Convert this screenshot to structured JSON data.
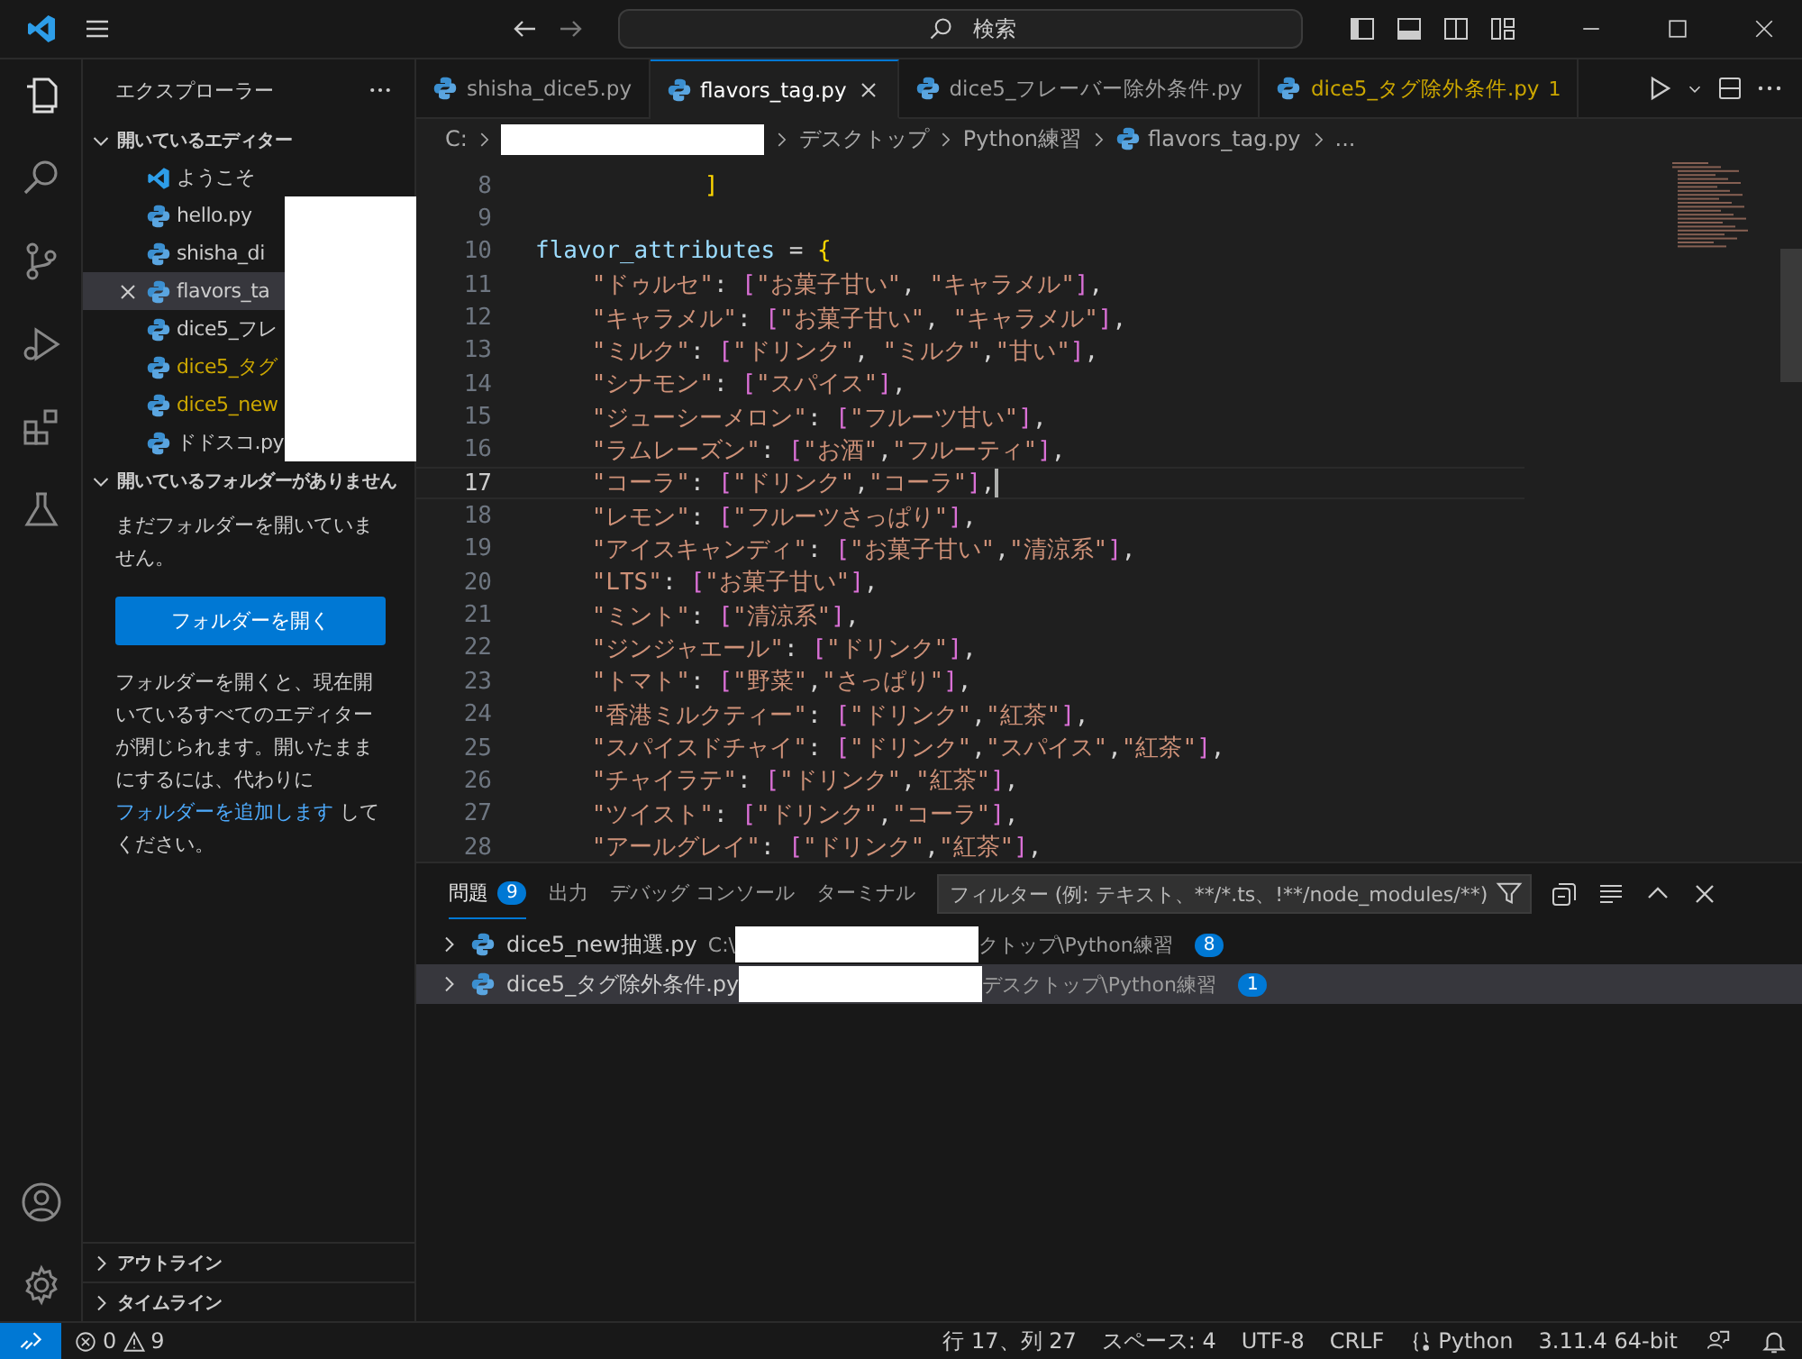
{
  "title_bar": {
    "search_placeholder": "検索"
  },
  "sidebar": {
    "title": "エクスプローラー",
    "open_editors": {
      "title": "開いているエディター",
      "expanded": true,
      "items": [
        {
          "label": "ようこそ",
          "kind": "welcome",
          "selected": false,
          "warning": false
        },
        {
          "label": "hello.py",
          "kind": "python",
          "selected": false,
          "warning": false
        },
        {
          "label": "shisha_di",
          "kind": "python",
          "selected": false,
          "warning": false
        },
        {
          "label": "flavors_ta",
          "kind": "python",
          "selected": true,
          "warning": false
        },
        {
          "label": "dice5_フレ",
          "kind": "python",
          "selected": false,
          "warning": false
        },
        {
          "label": "dice5_タグ",
          "kind": "python",
          "selected": false,
          "warning": true
        },
        {
          "label": "dice5_new",
          "kind": "python",
          "selected": false,
          "warning": true
        },
        {
          "label": "ドドスコ.py",
          "kind": "python",
          "selected": false,
          "warning": false
        }
      ]
    },
    "no_folder": {
      "title": "開いているフォルダーがありません",
      "expanded": true,
      "message": "まだフォルダーを開いていません。",
      "button": "フォルダーを開く",
      "note_before": "フォルダーを開くと、現在開いているすべてのエディターが閉じられます。開いたままにするには、代わりに ",
      "note_link": "フォルダーを追加します",
      "note_after": " してください。"
    },
    "bottom_sections": [
      {
        "title": "アウトライン",
        "expanded": false
      },
      {
        "title": "タイムライン",
        "expanded": false
      }
    ]
  },
  "tabs": [
    {
      "label": "shisha_dice5.py",
      "selected": false,
      "warning": false
    },
    {
      "label": "flavors_tag.py",
      "selected": true,
      "warning": false
    },
    {
      "label": "dice5_フレーバー除外条件.py",
      "selected": false,
      "warning": false
    },
    {
      "label": "dice5_タグ除外条件.py",
      "badge": "1",
      "selected": false,
      "warning": true
    }
  ],
  "breadcrumb": {
    "drive": "C:",
    "parts": [
      "デスクトップ",
      "Python練習",
      "flavors_tag.py",
      "..."
    ]
  },
  "code_lines": [
    {
      "number": "8",
      "text": "            ]",
      "current": false
    },
    {
      "number": "9",
      "current": false
    },
    {
      "number": "10",
      "text": "flavor_attributes = {",
      "current": false
    },
    {
      "number": "11",
      "text": "    \"ドゥルセ\": [\"お菓子甘い\", \"キャラメル\"],",
      "current": false
    },
    {
      "number": "12",
      "text": "    \"キャラメル\": [\"お菓子甘い\", \"キャラメル\"],",
      "current": false
    },
    {
      "number": "13",
      "text": "    \"ミルク\": [\"ドリンク\", \"ミルク\",\"甘い\"],",
      "current": false
    },
    {
      "number": "14",
      "text": "    \"シナモン\": [\"スパイス\"],",
      "current": false
    },
    {
      "number": "15",
      "text": "    \"ジューシーメロン\": [\"フルーツ甘い\"],",
      "current": false
    },
    {
      "number": "16",
      "text": "    \"ラムレーズン\": [\"お酒\",\"フルーティ\"],",
      "current": false
    },
    {
      "number": "17",
      "text": "    \"コーラ\": [\"ドリンク\",\"コーラ\"],",
      "current": true
    },
    {
      "number": "18",
      "text": "    \"レモン\": [\"フルーツさっぱり\"],",
      "current": false
    },
    {
      "number": "19",
      "text": "    \"アイスキャンディ\": [\"お菓子甘い\",\"清涼系\"],",
      "current": false
    },
    {
      "number": "20",
      "text": "    \"LTS\": [\"お菓子甘い\"],",
      "current": false
    },
    {
      "number": "21",
      "text": "    \"ミント\": [\"清涼系\"],",
      "current": false
    },
    {
      "number": "22",
      "text": "    \"ジンジャエール\": [\"ドリンク\"],",
      "current": false
    },
    {
      "number": "23",
      "text": "    \"トマト\": [\"野菜\",\"さっぱり\"],",
      "current": false
    },
    {
      "number": "24",
      "text": "    \"香港ミルクティー\": [\"ドリンク\",\"紅茶\"],",
      "current": false
    },
    {
      "number": "25",
      "text": "    \"スパイスドチャイ\": [\"ドリンク\",\"スパイス\",\"紅茶\"],",
      "current": false
    },
    {
      "number": "26",
      "text": "    \"チャイラテ\": [\"ドリンク\",\"紅茶\"],",
      "current": false
    },
    {
      "number": "27",
      "text": "    \"ツイスト\": [\"ドリンク\",\"コーラ\"],",
      "current": false
    },
    {
      "number": "28",
      "text": "    \"アールグレイ\": [\"ドリンク\",\"紅茶\"],",
      "current": false
    }
  ],
  "panel": {
    "tabs": [
      {
        "label": "問題",
        "badge": "9",
        "selected": true
      },
      {
        "label": "出力",
        "selected": false
      },
      {
        "label": "デバッグ コンソール",
        "selected": false
      },
      {
        "label": "ターミナル",
        "selected": false
      }
    ],
    "filter_placeholder": "フィルター (例: テキスト、**/*.ts、!**/node_modules/**)",
    "problems": [
      {
        "file": "dice5_new抽選.py",
        "path_start": "C:\\",
        "path_end": "クトップ\\Python練習",
        "count": "8",
        "expanded": false,
        "selected": false
      },
      {
        "file": "dice5_タグ除外条件.py",
        "path_end": "デスクトップ\\Python練習",
        "count": "1",
        "expanded": false,
        "selected": true
      }
    ]
  },
  "status_bar": {
    "errors": "0",
    "warnings": "9",
    "items": [
      "行 17、列 27",
      "スペース: 4",
      "UTF-8",
      "CRLF"
    ],
    "language": "Python",
    "interpreter": "3.11.4 64-bit"
  }
}
